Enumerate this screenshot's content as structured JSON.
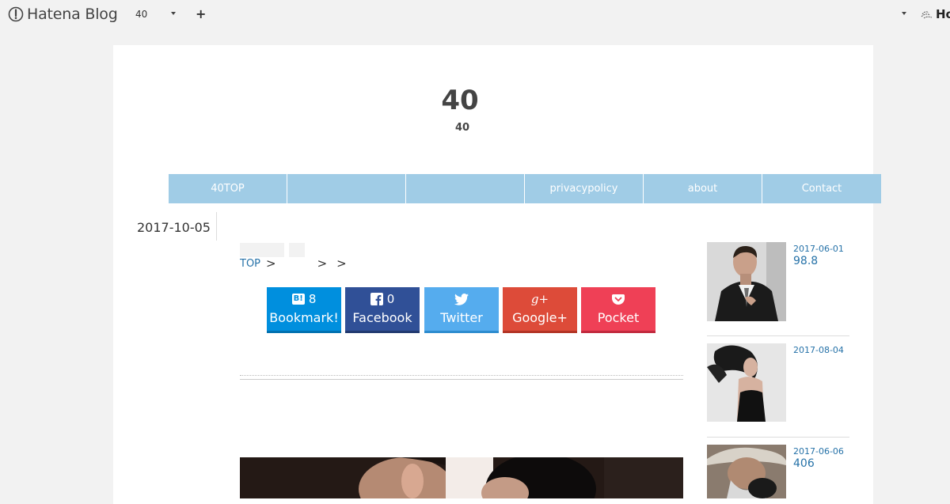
{
  "topbar": {
    "brand": "Hatena Blog",
    "blog_select": "40",
    "plus": "+",
    "right_brand": "Ho"
  },
  "blog": {
    "title": "40",
    "description": "40"
  },
  "nav": [
    {
      "label": "40TOP"
    },
    {
      "label": ""
    },
    {
      "label": ""
    },
    {
      "label": "privacypolicy"
    },
    {
      "label": "about"
    },
    {
      "label": "Contact"
    }
  ],
  "article": {
    "date": "2017-10-05",
    "breadcrumb": {
      "top": "TOP",
      "sep1": ">",
      "sep2": ">",
      "sep3": ">"
    }
  },
  "share": {
    "hatena": {
      "count": "8",
      "label": "Bookmark!",
      "icon": "B!"
    },
    "facebook": {
      "count": "0",
      "label": "Facebook"
    },
    "twitter": {
      "label": "Twitter"
    },
    "googleplus": {
      "label": "Google+",
      "icon": "g+"
    },
    "pocket": {
      "label": "Pocket"
    }
  },
  "sidebar": [
    {
      "date": "2017-06-01",
      "title": "98.8"
    },
    {
      "date": "2017-08-04",
      "title": ""
    },
    {
      "date": "2017-06-06",
      "title": "406"
    }
  ],
  "colors": {
    "nav_bg": "#a0cce6",
    "link": "#2672a8",
    "hatena": "#008fde",
    "facebook": "#305097",
    "twitter": "#55acee",
    "googleplus": "#dd4b39",
    "pocket": "#ef4056"
  }
}
